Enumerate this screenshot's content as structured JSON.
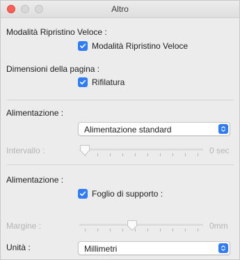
{
  "window": {
    "title": "Altro",
    "close_color": "#ff5f57"
  },
  "quick_restore": {
    "section_label": "Modalità Ripristino Veloce :",
    "checkbox_label": "Modalità Ripristino Veloce",
    "checked": true
  },
  "page_size": {
    "section_label": "Dimensioni della pagina :",
    "checkbox_label": "Rifilatura",
    "checked": true
  },
  "feeding": {
    "section_label": "Alimentazione :",
    "selected_option": "Alimentazione standard"
  },
  "interval": {
    "label": "Intervallo :",
    "value_text": "0 sec",
    "level": 0,
    "enabled": false
  },
  "feeding2": {
    "section_label": "Alimentazione :",
    "checkbox_label": "Foglio di supporto :",
    "checked": true
  },
  "margin": {
    "label": "Margine :",
    "value_text": "0mm",
    "level": 0.42,
    "enabled": false
  },
  "units": {
    "label": "Unità :",
    "selected_option": "Millimetri"
  },
  "accent_color": "#2f7cf6",
  "icons": {
    "checkbox": "checkmark-icon",
    "select": "updown-chevron-icon"
  }
}
